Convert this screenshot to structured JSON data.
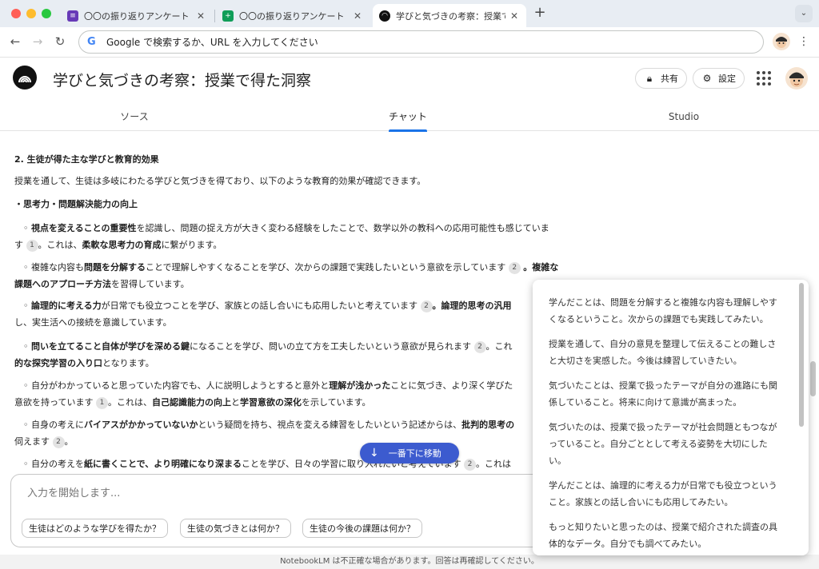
{
  "browser": {
    "tabs": [
      {
        "title": "〇〇の振り返りアンケート - Goo",
        "icon": "google-forms-icon",
        "color": "#673ab7"
      },
      {
        "title": "〇〇の振り返りアンケート（回答",
        "icon": "google-sheets-icon",
        "color": "#0f9d58"
      },
      {
        "title": "学びと気づきの考察：授業で得た",
        "icon": "notebooklm-icon",
        "color": "#111111"
      }
    ],
    "omnibox_text": "Google で検索するか、URL を入力してください"
  },
  "header": {
    "title": "学びと気づきの考察：授業で得た洞察",
    "share_label": "共有",
    "settings_label": "設定"
  },
  "main_tabs": [
    {
      "label": "ソース"
    },
    {
      "label": "チャット",
      "active": true
    },
    {
      "label": "Studio"
    }
  ],
  "chat": {
    "section_heading": "2. 生徒が得た主な学びと教育的効果",
    "intro": "授業を通して、生徒は多岐にわたる学びと気づきを得ており、以下のような教育的効果が確認できます。",
    "subheading": "・思考力・問題解決能力の向上",
    "p1": {
      "a_bold": "視点を変えることの重要性",
      "b": "を認識し、問題の捉え方が大きく変わる経験をしたことで、数学以外の教科への応用可能性も感じていま",
      "c": "す",
      "cite1": "1",
      "d": "。これは、",
      "e_bold": "柔軟な思考力の育成",
      "f": "に繋がります。"
    },
    "p2": {
      "a": "複雑な内容も",
      "b_bold": "問題を分解する",
      "c": "ことで理解しやすくなることを学び、次からの課題で実践したいという意欲を示しています",
      "cite1": "2",
      "d_bold": "。複雑な",
      "e_bold": "課題へのアプローチ方法",
      "f": "を習得しています。"
    },
    "p3": {
      "a_bold": "論理的に考える力",
      "b": "が日常でも役立つことを学び、家族との話し合いにも応用したいと考えています",
      "cite1": "2",
      "c_bold": "。論理的思考の汎用",
      "d": "し、実生活への接続を意識しています。"
    },
    "p4": {
      "a_bold": "問いを立てること自体が学びを深める鍵",
      "b": "になることを学び、問いの立て方を工夫したいという意欲が見られます",
      "cite1": "2",
      "c": "。これ",
      "d_bold": "的な探究学習の入り口",
      "e": "となります。"
    },
    "p5": {
      "a": "自分がわかっていると思っていた内容でも、人に説明しようとすると意外と",
      "b_bold": "理解が浅かった",
      "c": "ことに気づき、より深く学びた",
      "d": "意欲を持っています",
      "cite1": "1",
      "e": "。これは、",
      "f_bold": "自己認識能力の向上",
      "g": "と",
      "h_bold": "学習意欲の深化",
      "i": "を示しています。"
    },
    "p6": {
      "a": "自身の考えに",
      "b_bold": "バイアスがかかっていないか",
      "c": "という疑問を持ち、視点を変える練習をしたいという記述からは、",
      "d_bold": "批判的思考の",
      "e": "伺えます",
      "cite1": "2",
      "f": "。"
    },
    "p7": {
      "a": "自分の考えを",
      "b_bold": "紙に書くことで、より明確になり深まる",
      "c": "ことを学び、日々の学習に取り入れたいと考えています",
      "cite1": "2",
      "d": "。これは"
    },
    "jump_label": "一番下に移動"
  },
  "composer": {
    "placeholder": "入力を開始します...",
    "suggestions": [
      "生徒はどのような学びを得たか？",
      "生徒の気づきとは何か？",
      "生徒の今後の課題は何か？"
    ]
  },
  "footer_note": "NotebookLM は不正確な場合があります。回答は再確認してください。",
  "popup": {
    "items": [
      "学んだことは、問題を分解すると複雑な内容も理解しやすくなるということ。次からの課題でも実践してみたい。",
      "授業を通して、自分の意見を整理して伝えることの難しさと大切さを実感した。今後は練習していきたい。",
      "気づいたことは、授業で扱ったテーマが自分の進路にも関係していること。将来に向けて意識が高まった。",
      "気づいたのは、授業で扱ったテーマが社会問題ともつながっていること。自分ごととして考える姿勢を大切にしたい。",
      "学んだことは、論理的に考える力が日常でも役立つということ。家族との話し合いにも応用してみたい。",
      "もっと知りたいと思ったのは、授業で紹介された調査の具体的なデータ。自分でも調べてみたい。"
    ]
  }
}
